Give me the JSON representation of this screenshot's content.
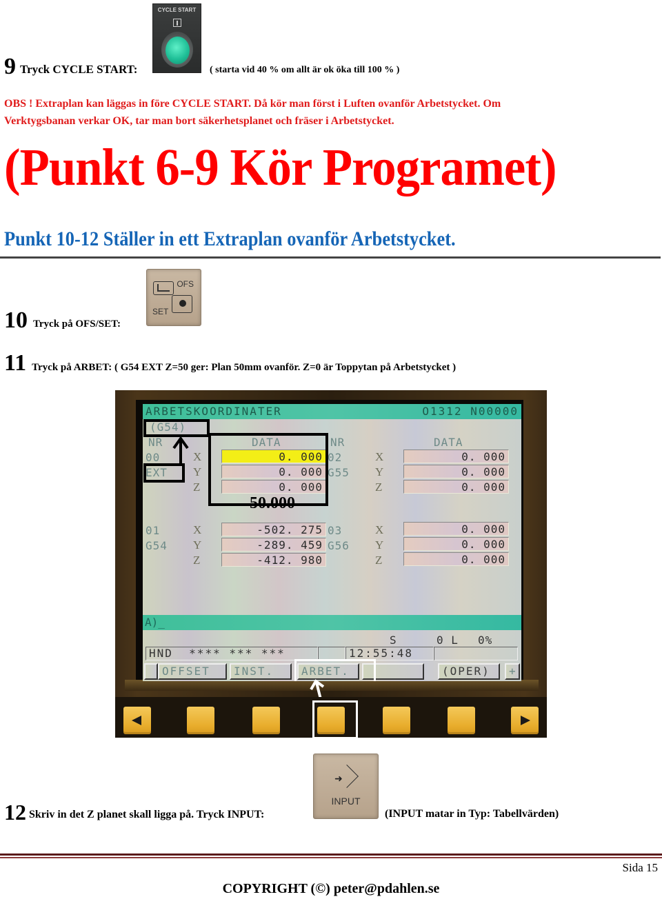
{
  "step9": {
    "number": "9",
    "text": "Tryck CYCLE START:",
    "button": {
      "label": "CYCLE START",
      "icon": "cycle-start-lamp-icon",
      "lamp_color": "#1fbf97"
    },
    "note": "( starta vid 40 % om allt är ok öka till 100 % )"
  },
  "obs": {
    "line1": "OBS ! Extraplan kan läggas in före CYCLE START. Då kör man först i Luften ovanför Arbetstycket. Om",
    "line2": "Verktygsbanan verkar OK, tar man bort säkerhetsplanet och fräser i Arbetstycket.",
    "color": "#e01b1b"
  },
  "title": {
    "text": "(Punkt 6-9 Kör Programet)",
    "color": "#ff0000"
  },
  "subtitle": {
    "text": "Punkt 10-12 Ställer in ett Extraplan ovanför Arbetstycket.",
    "color": "#1565b6"
  },
  "step10": {
    "number": "10",
    "text": "Tryck på OFS/SET:",
    "key": {
      "top_label": "OFS",
      "bottom_label": "SET",
      "icon": "offset-setting-icon"
    }
  },
  "step11": {
    "number": "11",
    "text": "Tryck på ARBET: ( G54 EXT Z=50 ger: Plan 50mm ovanför. Z=0 är Toppytan på Arbetstycket )"
  },
  "cnc": {
    "header_title": "ARBETSKOORDINATER",
    "program": "O1312 N00000",
    "current_coord": "(G54)",
    "col_nr": "NR",
    "col_data": "DATA",
    "groups": [
      {
        "nr": "00",
        "name": "EXT",
        "values": {
          "X": "0. 000",
          "Y": "0. 000",
          "Z": "0. 000"
        },
        "highlight_axis": "X"
      },
      {
        "nr": "02",
        "name": "G55",
        "values": {
          "X": "0. 000",
          "Y": "0. 000",
          "Z": "0. 000"
        }
      },
      {
        "nr": "01",
        "name": "G54",
        "values": {
          "X": "-502. 275",
          "Y": "-289. 459",
          "Z": "-412. 980"
        }
      },
      {
        "nr": "03",
        "name": "G56",
        "values": {
          "X": "0. 000",
          "Y": "0. 000",
          "Z": "0. 000"
        }
      }
    ],
    "annotation_value": "50.000",
    "input_prompt": "A)_",
    "status": {
      "s": "S",
      "l": "0 L",
      "pct": "0%"
    },
    "mode": "HND",
    "mode_stars": "****  ***  ***",
    "clock": "12:55:48",
    "softkeys": [
      "OFFSET",
      "INST.",
      "ARBET.",
      "",
      "(OPER)",
      "+"
    ],
    "selected_softkey": "ARBET.",
    "highlight_color": "#f3ee16"
  },
  "step12": {
    "number": "12",
    "text": "Skriv in det Z planet skall ligga på. Tryck INPUT:",
    "key": {
      "label": "INPUT",
      "icon": "input-arrow-icon"
    },
    "note": "(INPUT matar in Typ: Tabellvärden)"
  },
  "footer": {
    "page": "Sida 15",
    "copyright": "COPYRIGHT (©) peter@pdahlen.se"
  }
}
